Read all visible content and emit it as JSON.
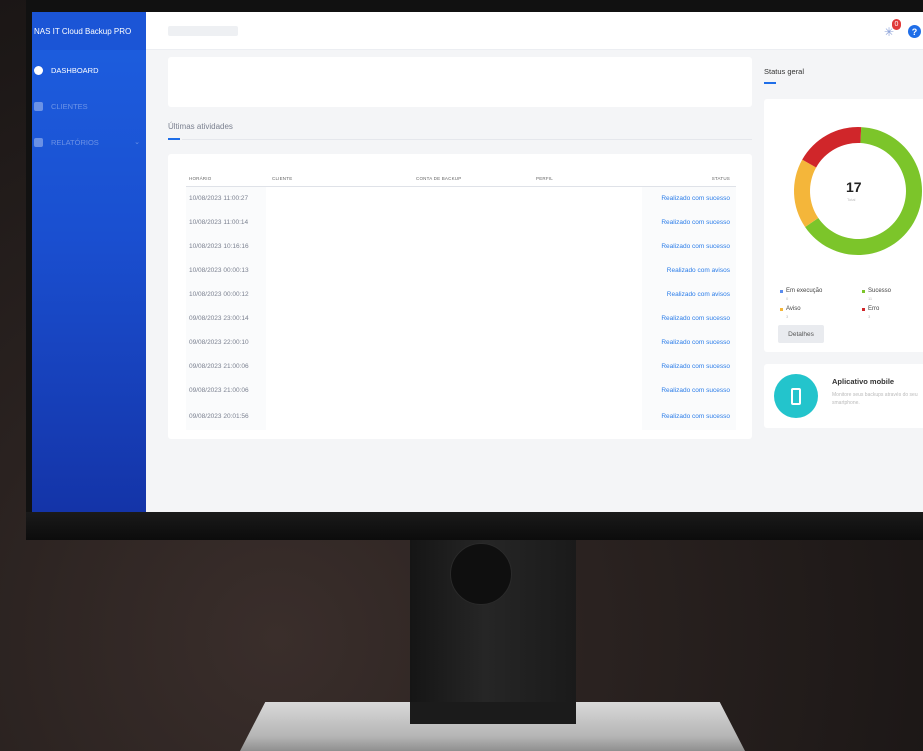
{
  "app": {
    "brand": "NAS IT Cloud Backup PRO"
  },
  "sidebar": {
    "items": [
      {
        "label": "DASHBOARD",
        "icon": "dashboard-icon"
      },
      {
        "label": "CLIENTES",
        "icon": "clients-icon"
      },
      {
        "label": "RELATÓRIOS",
        "icon": "reports-icon"
      }
    ]
  },
  "header": {
    "notification_count": "0"
  },
  "activities": {
    "title": "Últimas atividades",
    "columns": [
      "HORÁRIO",
      "CLIENTE",
      "CONTA DE BACKUP",
      "PERFIL",
      "STATUS"
    ],
    "rows": [
      {
        "time": "10/08/2023 11:00:27",
        "status": "Realizado com sucesso"
      },
      {
        "time": "10/08/2023 11:00:14",
        "status": "Realizado com sucesso"
      },
      {
        "time": "10/08/2023 10:16:16",
        "status": "Realizado com sucesso"
      },
      {
        "time": "10/08/2023 00:00:13",
        "status": "Realizado com avisos"
      },
      {
        "time": "10/08/2023 00:00:12",
        "status": "Realizado com avisos"
      },
      {
        "time": "09/08/2023 23:00:14",
        "status": "Realizado com sucesso"
      },
      {
        "time": "09/08/2023 22:00:10",
        "status": "Realizado com sucesso"
      },
      {
        "time": "09/08/2023 21:00:06",
        "status": "Realizado com sucesso"
      },
      {
        "time": "09/08/2023 21:00:06",
        "status": "Realizado com sucesso"
      },
      {
        "time": "09/08/2023 20:01:56",
        "status": "Realizado com sucesso"
      }
    ]
  },
  "status_geral": {
    "title": "Status geral",
    "total": "17",
    "total_label": "Total",
    "legend": [
      {
        "label": "Em execução",
        "count": "0",
        "color": "#5b8def"
      },
      {
        "label": "Sucesso",
        "count": "11",
        "color": "#7cc52a"
      },
      {
        "label": "Aviso",
        "count": "3",
        "color": "#f4b63a"
      },
      {
        "label": "Erro",
        "count": "3",
        "color": "#d0262a"
      }
    ],
    "segments": [
      {
        "name": "Sucesso",
        "value": 11,
        "color": "#7cc52a"
      },
      {
        "name": "Aviso",
        "value": 3,
        "color": "#f4b63a"
      },
      {
        "name": "Erro",
        "value": 3,
        "color": "#d0262a"
      }
    ],
    "details_button": "Detalhes"
  },
  "mobile": {
    "title": "Aplicativo mobile",
    "description": "Monitore seus backups através do seu smartphone."
  }
}
